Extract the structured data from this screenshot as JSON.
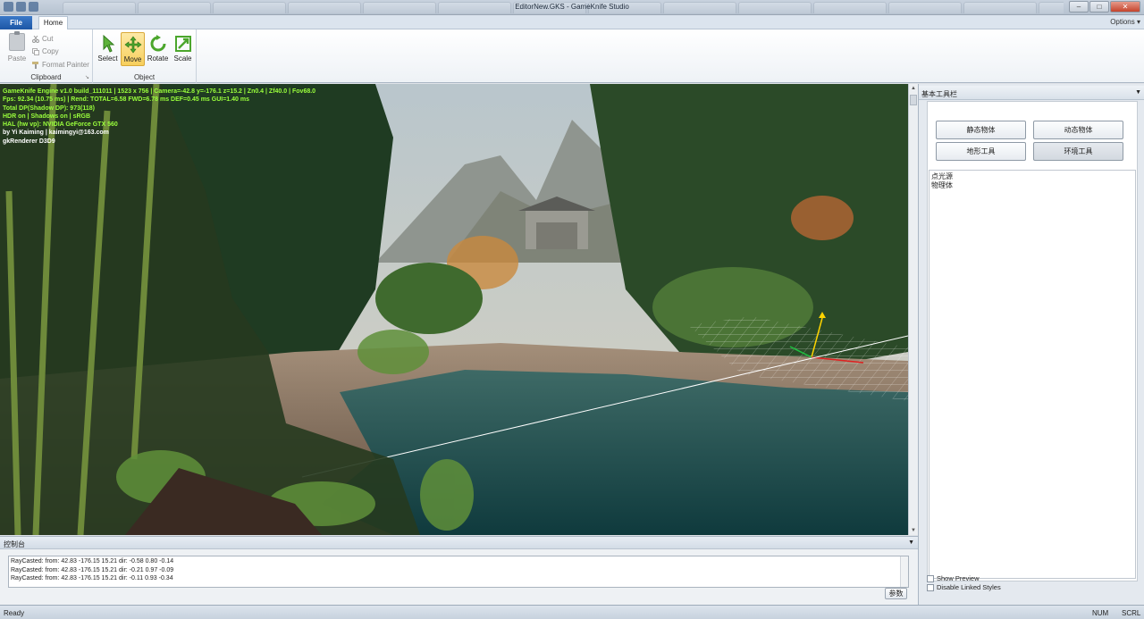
{
  "window": {
    "title": "EditorNew.GKS - GameKnife Studio",
    "controls": {
      "minimize": "–",
      "maximize": "□",
      "close": "✕"
    }
  },
  "ribbon": {
    "tabs": {
      "file": "File",
      "home": "Home"
    },
    "options_label": "Options ▾",
    "clipboard": {
      "paste": "Paste",
      "cut": "Cut",
      "copy": "Copy",
      "format_painter": "Format Painter",
      "group_label": "Clipboard"
    },
    "object": {
      "select": "Select",
      "move": "Move",
      "rotate": "Rotate",
      "scale": "Scale",
      "group_label": "Object",
      "active_tool": "move"
    }
  },
  "viewport": {
    "hud_lines": [
      {
        "text": "GameKnife Engine v1.0 build_111011 | 1523 x 756 | Camera=-42.8 y=-176.1 z=15.2 | Zn0.4 | Zf40.0 | Fov68.0",
        "color": "#9aff3c"
      },
      {
        "text": "Fps: 92.34 (10.75 ms) | Rend: TOTAL=6.58 FWD=6.78 ms DEF=0.45 ms GUI=1.40 ms",
        "color": "#9aff3c"
      },
      {
        "text": "Total DP(Shadow DP): 973(118)",
        "color": "#9aff3c"
      },
      {
        "text": "HDR on | Shadows on | sRGB",
        "color": "#9aff3c"
      },
      {
        "text": "HAL (hw vp): NVIDIA GeForce GTX 560",
        "color": "#9aff3c"
      },
      {
        "text": "by Yi Kaiming | kaimingyi@163.com",
        "color": "#ffffff"
      },
      {
        "text": "gkRenderer D3D9",
        "color": "#ffffff"
      }
    ]
  },
  "console": {
    "title": "控制台",
    "lines": [
      "RayCasted: from: 42.83 -176.15 15.21 dir: -0.58 0.80 -0.14",
      "RayCasted: from: 42.83 -176.15 15.21 dir: -0.21 0.97 -0.09",
      "RayCasted: from: 42.83 -176.15 15.21 dir: -0.11 0.93 -0.34"
    ],
    "param_button": "参数"
  },
  "right_panel": {
    "title": "基本工具栏",
    "buttons": [
      "静态物体",
      "动态物体",
      "地形工具",
      "环境工具"
    ],
    "list_items": [
      "点光源",
      "物理体"
    ],
    "checkboxes": [
      "Show Preview",
      "Disable Linked Styles"
    ]
  },
  "status": {
    "left": "Ready",
    "num": "NUM",
    "scrl": "SCRL"
  },
  "colors": {
    "accent": "#1d57a6",
    "active_tool": "#f7cf5c",
    "hud_green": "#9aff3c"
  }
}
